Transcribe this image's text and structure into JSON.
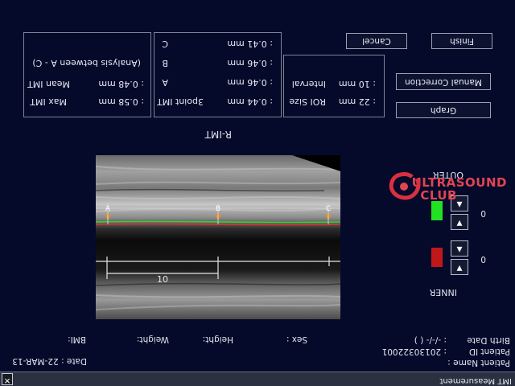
{
  "window": {
    "title": "IMT Measurement",
    "close_glyph": "✕"
  },
  "patient": {
    "name_label": "Patient Name :",
    "name_value": "",
    "id_label": "Patient ID",
    "id_value": ": 20130322001",
    "birth_label": "Birth Date",
    "birth_value": ": -/-/- (  )",
    "sex_label": "Sex :",
    "height_label": "Height:",
    "weight_label": "Weight:",
    "bmi_label": "BMI:",
    "date": "Date : 22-MAR-13"
  },
  "stats": {
    "max_label": "Max IMT",
    "max_value": ": 0.58 mm",
    "mean_label": "Mean IMT",
    "mean_value": ": 0.48 mm",
    "range_note": "(Analysis between A - C)"
  },
  "points": {
    "three_label": "3point IMT",
    "three_value": ": 0.44 mm",
    "a_label": "A",
    "a_value": ": 0.46 mm",
    "b_label": "B",
    "b_value": ": 0.46 mm",
    "c_label": "C",
    "c_value": ": 0.41 mm"
  },
  "roi": {
    "size_label": "ROI Size",
    "size_value": ": 22 mm",
    "interval_label": "Interval",
    "interval_value": ": 10 mm"
  },
  "buttons": {
    "cancel": "Cancel",
    "finish": "Finish",
    "manual": "Manual Correction",
    "graph": "Graph"
  },
  "side_label": "R-IMT",
  "image": {
    "markers": [
      "A",
      "B",
      "C"
    ],
    "scale_label": "10",
    "colors": {
      "intima": "#2bd62b",
      "adventitia": "#e03030",
      "marker": "#f08a1a"
    }
  },
  "outer": {
    "label": "OUTER",
    "value": "0",
    "color": "#22e022",
    "up": "▲",
    "down": "▼"
  },
  "inner": {
    "label": "INNER",
    "value": "0",
    "color": "#c01818",
    "up": "▲",
    "down": "▼"
  },
  "logo": {
    "line1": "ULTRASOUND",
    "line2": "CLUB"
  }
}
